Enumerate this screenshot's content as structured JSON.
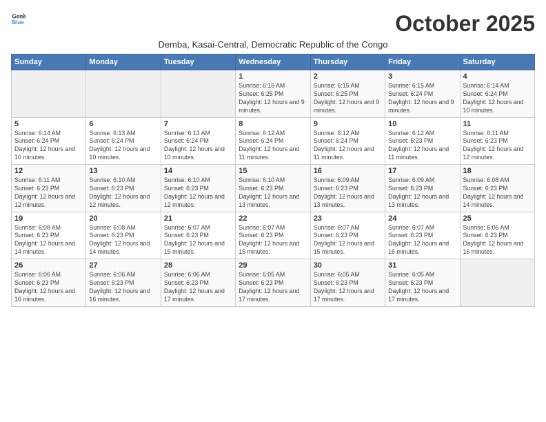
{
  "logo": {
    "line1": "General",
    "line2": "Blue"
  },
  "title": "October 2025",
  "subtitle": "Demba, Kasai-Central, Democratic Republic of the Congo",
  "days_of_week": [
    "Sunday",
    "Monday",
    "Tuesday",
    "Wednesday",
    "Thursday",
    "Friday",
    "Saturday"
  ],
  "weeks": [
    [
      {
        "day": "",
        "info": ""
      },
      {
        "day": "",
        "info": ""
      },
      {
        "day": "",
        "info": ""
      },
      {
        "day": "1",
        "info": "Sunrise: 6:16 AM\nSunset: 6:25 PM\nDaylight: 12 hours and 9 minutes."
      },
      {
        "day": "2",
        "info": "Sunrise: 6:15 AM\nSunset: 6:25 PM\nDaylight: 12 hours and 9 minutes."
      },
      {
        "day": "3",
        "info": "Sunrise: 6:15 AM\nSunset: 6:24 PM\nDaylight: 12 hours and 9 minutes."
      },
      {
        "day": "4",
        "info": "Sunrise: 6:14 AM\nSunset: 6:24 PM\nDaylight: 12 hours and 10 minutes."
      }
    ],
    [
      {
        "day": "5",
        "info": "Sunrise: 6:14 AM\nSunset: 6:24 PM\nDaylight: 12 hours and 10 minutes."
      },
      {
        "day": "6",
        "info": "Sunrise: 6:13 AM\nSunset: 6:24 PM\nDaylight: 12 hours and 10 minutes."
      },
      {
        "day": "7",
        "info": "Sunrise: 6:13 AM\nSunset: 6:24 PM\nDaylight: 12 hours and 10 minutes."
      },
      {
        "day": "8",
        "info": "Sunrise: 6:12 AM\nSunset: 6:24 PM\nDaylight: 12 hours and 11 minutes."
      },
      {
        "day": "9",
        "info": "Sunrise: 6:12 AM\nSunset: 6:24 PM\nDaylight: 12 hours and 11 minutes."
      },
      {
        "day": "10",
        "info": "Sunrise: 6:12 AM\nSunset: 6:23 PM\nDaylight: 12 hours and 11 minutes."
      },
      {
        "day": "11",
        "info": "Sunrise: 6:11 AM\nSunset: 6:23 PM\nDaylight: 12 hours and 12 minutes."
      }
    ],
    [
      {
        "day": "12",
        "info": "Sunrise: 6:11 AM\nSunset: 6:23 PM\nDaylight: 12 hours and 12 minutes."
      },
      {
        "day": "13",
        "info": "Sunrise: 6:10 AM\nSunset: 6:23 PM\nDaylight: 12 hours and 12 minutes."
      },
      {
        "day": "14",
        "info": "Sunrise: 6:10 AM\nSunset: 6:23 PM\nDaylight: 12 hours and 12 minutes."
      },
      {
        "day": "15",
        "info": "Sunrise: 6:10 AM\nSunset: 6:23 PM\nDaylight: 12 hours and 13 minutes."
      },
      {
        "day": "16",
        "info": "Sunrise: 6:09 AM\nSunset: 6:23 PM\nDaylight: 12 hours and 13 minutes."
      },
      {
        "day": "17",
        "info": "Sunrise: 6:09 AM\nSunset: 6:23 PM\nDaylight: 12 hours and 13 minutes."
      },
      {
        "day": "18",
        "info": "Sunrise: 6:08 AM\nSunset: 6:23 PM\nDaylight: 12 hours and 14 minutes."
      }
    ],
    [
      {
        "day": "19",
        "info": "Sunrise: 6:08 AM\nSunset: 6:23 PM\nDaylight: 12 hours and 14 minutes."
      },
      {
        "day": "20",
        "info": "Sunrise: 6:08 AM\nSunset: 6:23 PM\nDaylight: 12 hours and 14 minutes."
      },
      {
        "day": "21",
        "info": "Sunrise: 6:07 AM\nSunset: 6:23 PM\nDaylight: 12 hours and 15 minutes."
      },
      {
        "day": "22",
        "info": "Sunrise: 6:07 AM\nSunset: 6:23 PM\nDaylight: 12 hours and 15 minutes."
      },
      {
        "day": "23",
        "info": "Sunrise: 6:07 AM\nSunset: 6:23 PM\nDaylight: 12 hours and 15 minutes."
      },
      {
        "day": "24",
        "info": "Sunrise: 6:07 AM\nSunset: 6:23 PM\nDaylight: 12 hours and 16 minutes."
      },
      {
        "day": "25",
        "info": "Sunrise: 6:06 AM\nSunset: 6:23 PM\nDaylight: 12 hours and 16 minutes."
      }
    ],
    [
      {
        "day": "26",
        "info": "Sunrise: 6:06 AM\nSunset: 6:23 PM\nDaylight: 12 hours and 16 minutes."
      },
      {
        "day": "27",
        "info": "Sunrise: 6:06 AM\nSunset: 6:23 PM\nDaylight: 12 hours and 16 minutes."
      },
      {
        "day": "28",
        "info": "Sunrise: 6:06 AM\nSunset: 6:23 PM\nDaylight: 12 hours and 17 minutes."
      },
      {
        "day": "29",
        "info": "Sunrise: 6:05 AM\nSunset: 6:23 PM\nDaylight: 12 hours and 17 minutes."
      },
      {
        "day": "30",
        "info": "Sunrise: 6:05 AM\nSunset: 6:23 PM\nDaylight: 12 hours and 17 minutes."
      },
      {
        "day": "31",
        "info": "Sunrise: 6:05 AM\nSunset: 6:23 PM\nDaylight: 12 hours and 17 minutes."
      },
      {
        "day": "",
        "info": ""
      }
    ]
  ]
}
